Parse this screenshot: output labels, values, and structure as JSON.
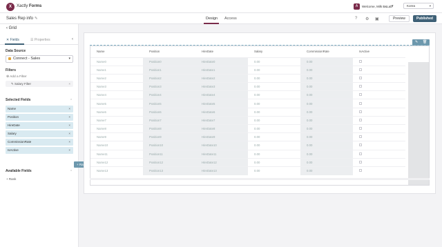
{
  "app": {
    "logo_letter": "X",
    "name_prefix": "Xactly",
    "name_suffix": "Forms"
  },
  "user": {
    "avatar": "A",
    "name": "Welcome, Milk B&Lab"
  },
  "language": {
    "selected": "Korea"
  },
  "form": {
    "name": "Sales Rep info"
  },
  "tabs": {
    "design": "Design",
    "access": "Access"
  },
  "actions": {
    "preview": "Preview",
    "published": "Published"
  },
  "left": {
    "back_label": "Grid",
    "tab_fields": "Fields",
    "tab_properties": "Properties",
    "data_source_title": "Data Source",
    "data_source_value": "Connect - Sales",
    "filters_title": "Filters",
    "add_filter": "Add a Filter",
    "filter_chip": "Salary Filter",
    "selected_fields_title": "Selected Fields",
    "selected_fields": [
      "Name",
      "Position",
      "HireDate",
      "Salary",
      "CommissionRate",
      "IsActive"
    ],
    "available_fields_title": "Available Fields",
    "available_fields": [
      "Rank"
    ]
  },
  "drag_ghost": "Rank",
  "grid": {
    "columns": [
      "Name",
      "Position",
      "HireDate",
      "Salary",
      "CommissionRate",
      "IsActive"
    ],
    "rows": [
      [
        "Name0",
        "Position0",
        "HireDate0",
        "0.00",
        "0.00"
      ],
      [
        "Name1",
        "Position1",
        "HireDate1",
        "0.00",
        "0.00"
      ],
      [
        "Name2",
        "Position2",
        "HireDate2",
        "0.00",
        "0.00"
      ],
      [
        "Name3",
        "Position3",
        "HireDate3",
        "0.00",
        "0.00"
      ],
      [
        "Name4",
        "Position4",
        "HireDate4",
        "0.00",
        "0.00"
      ],
      [
        "Name5",
        "Position5",
        "HireDate5",
        "0.00",
        "0.00"
      ],
      [
        "Name6",
        "Position6",
        "HireDate6",
        "0.00",
        "0.00"
      ],
      [
        "Name7",
        "Position7",
        "HireDate7",
        "0.00",
        "0.00"
      ],
      [
        "Name8",
        "Position8",
        "HireDate8",
        "0.00",
        "0.00"
      ],
      [
        "Name9",
        "Position9",
        "HireDate9",
        "0.00",
        "0.00"
      ],
      [
        "Name10",
        "Position10",
        "HireDate10",
        "0.00",
        "0.00"
      ],
      [
        "Name11",
        "Position11",
        "HireDate11",
        "0.00",
        "0.00"
      ],
      [
        "Name12",
        "Position12",
        "HireDate12",
        "0.00",
        "0.00"
      ],
      [
        "Name13",
        "Position13",
        "HireDate13",
        "0.00",
        "0.00"
      ]
    ]
  },
  "colors": {
    "brand": "#7a2b4a",
    "accent": "#3f6177",
    "chip": "#d9eaf1",
    "drag": "#6d98ad"
  }
}
